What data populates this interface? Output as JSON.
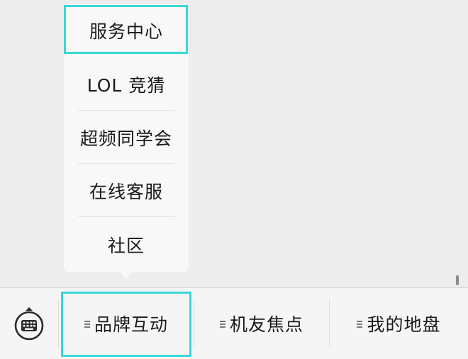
{
  "popup_menu": {
    "items": [
      {
        "label": "服务中心"
      },
      {
        "label": "LOL 竞猜"
      },
      {
        "label": "超频同学会"
      },
      {
        "label": "在线客服"
      },
      {
        "label": "社区"
      }
    ]
  },
  "bottom_bar": {
    "keyboard_icon": "keyboard-icon",
    "menus": [
      {
        "label": "品牌互动",
        "icon": "menu-lines-icon"
      },
      {
        "label": "机友焦点",
        "icon": "menu-lines-icon"
      },
      {
        "label": "我的地盘",
        "icon": "menu-lines-icon"
      }
    ]
  },
  "colors": {
    "highlight": "#3ad7d7",
    "background": "#ededed",
    "bar_background": "#f5f5f5",
    "popup_background": "#f8f8f8"
  }
}
